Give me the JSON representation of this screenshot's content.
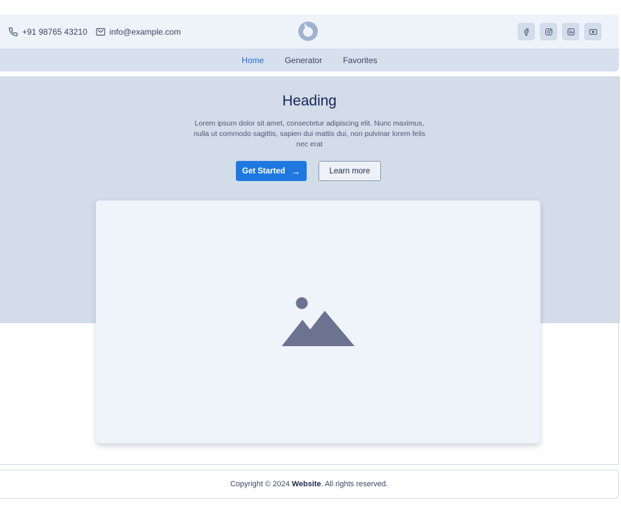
{
  "topbar": {
    "phone": "+91 98765 43210",
    "email": "info@example.com",
    "phone_icon": "phone-icon",
    "email_icon": "mail-icon",
    "logo_icon": "logo-icon",
    "socials": [
      "facebook-icon",
      "instagram-icon",
      "linkedin-icon",
      "youtube-icon"
    ]
  },
  "nav": {
    "items": [
      {
        "label": "Home",
        "active": true
      },
      {
        "label": "Generator",
        "active": false
      },
      {
        "label": "Favorites",
        "active": false
      }
    ]
  },
  "hero": {
    "heading": "Heading",
    "description": "Lorem ipsum dolor sit amet, consectetur adipiscing elit. Nunc maximus, nulla ut commodo sagittis, sapien dui mattis dui, non pulvinar lorem felis nec erat",
    "primary_button": "Get Started",
    "secondary_button": "Learn more",
    "image_icon": "image-placeholder-icon"
  },
  "footer": {
    "prefix": "Copyright © 2024",
    "brand": "Website",
    "suffix": ". All rights reserved."
  },
  "colors": {
    "accent": "#1f78e0",
    "hero_bg": "#d3dce9",
    "card_bg": "#eff3fa"
  }
}
